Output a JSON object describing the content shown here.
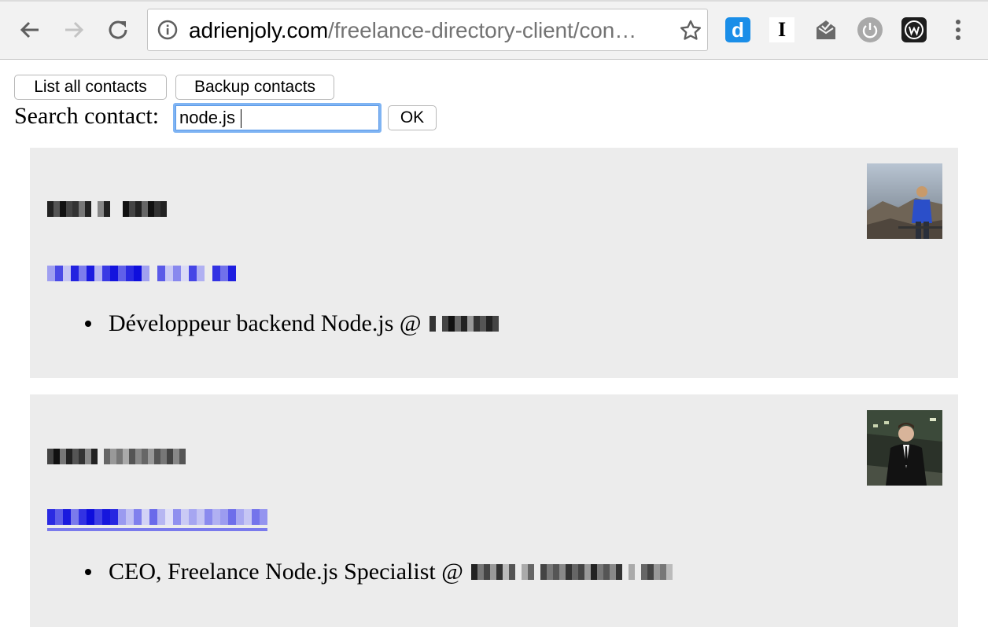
{
  "browser": {
    "url_host": "adrienjoly.com",
    "url_path": "/freelance-directory-client/con…"
  },
  "toolbar": {
    "list_all_label": "List all contacts",
    "backup_label": "Backup contacts"
  },
  "search": {
    "label": "Search contact:",
    "value": "node.js",
    "ok_label": "OK"
  },
  "extensions": {
    "d_letter": "d",
    "i_letter": "I"
  },
  "contacts": [
    {
      "role": "Développeur backend Node.js @"
    },
    {
      "role": "CEO, Freelance Node.js Specialist @"
    }
  ],
  "colors": {
    "card_bg": "#ececec",
    "focus_ring": "#7fb4f3",
    "link_blurred": "#1e1ee8"
  }
}
